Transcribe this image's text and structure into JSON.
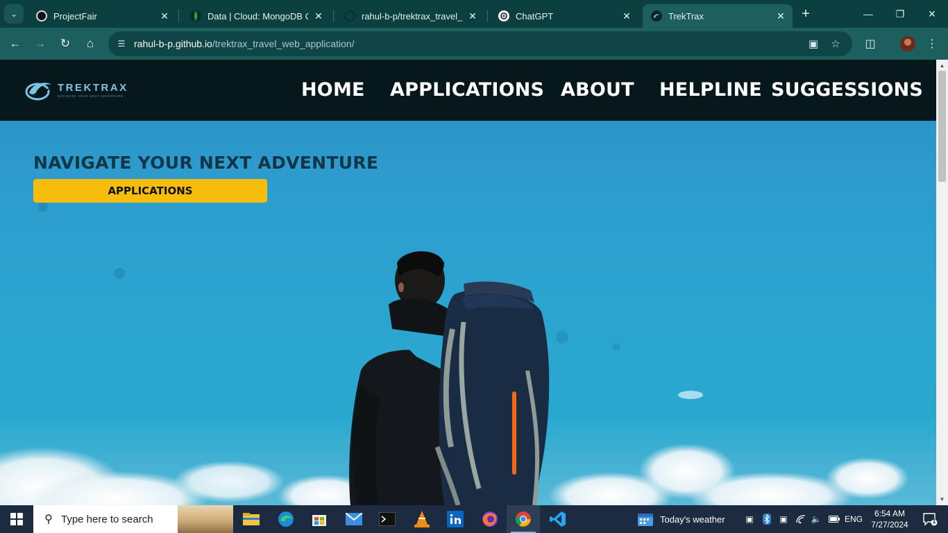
{
  "browser": {
    "tabs": [
      {
        "title": "ProjectFair",
        "active": false
      },
      {
        "title": "Data | Cloud: MongoDB Cloud",
        "active": false
      },
      {
        "title": "rahul-b-p/trektrax_travel_web_application",
        "active": false
      },
      {
        "title": "ChatGPT",
        "active": false
      },
      {
        "title": "TrekTrax",
        "active": true
      }
    ],
    "url_host": "rahul-b-p.github.io",
    "url_path": "/trektrax_travel_web_application/"
  },
  "site": {
    "logo_text": "TREKTRAX",
    "logo_tagline": "NAVIGATE YOUR NEXT ADVENTURE",
    "nav": [
      "HOME",
      "APPLICATIONS",
      "ABOUT",
      "HELPLINE",
      "SUGGESSIONS"
    ],
    "hero_title": "NAVIGATE YOUR NEXT ADVENTURE",
    "hero_button": "APPLICATIONS"
  },
  "taskbar": {
    "search_placeholder": "Type here to search",
    "weather": "Today's weather",
    "language": "ENG",
    "time": "6:54 AM",
    "date": "7/27/2024",
    "notification_count": "1"
  },
  "colors": {
    "chrome_tabbar": "#0c3f40",
    "chrome_toolbar": "#1d5e5f",
    "site_header": "#07181c",
    "hero_button": "#f7bd0d",
    "hero_title": "#123648"
  }
}
